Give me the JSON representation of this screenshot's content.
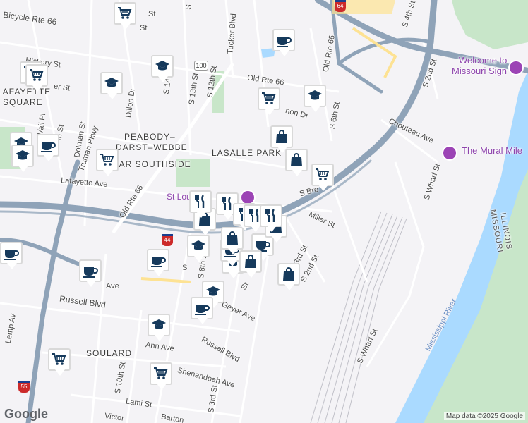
{
  "map": {
    "colors": {
      "land": "#f4f3f6",
      "water": "#aadaff",
      "park": "#c8e6c9",
      "highway": "#8fa3b8",
      "road": "#ffffff",
      "rail": "#b8b8c0",
      "pin_icon": "#163a5c",
      "poi": "#9c44b5"
    },
    "neighborhoods": {
      "lafayette_square_1": "LAFAYETTE",
      "lafayette_square_2": "SQUARE",
      "peabody_1": "PEABODY–",
      "peabody_2": "DARST–WEBBE",
      "lasalle_park": "LASALLE PARK",
      "near_southside": "NEAR SOUTHSIDE",
      "soulard": "SOULARD"
    },
    "roads": {
      "bicycle_rte": "Bicycle Rte 66",
      "old_rte_66_top": "Old Rte 66",
      "old_rte_66_mid": "Old Rte 66",
      "old_rte_66_left": "Old Rte 66",
      "tucker_blvd": "Tucker Blvd",
      "s_14th": "S 14th",
      "s_13th": "S 13th St",
      "s_12th": "S 12th St",
      "s_6th": "S 6th St",
      "s_4th": "S 4th St",
      "s_2nd_top": "S 2nd St",
      "s_2nd": "S 2nd St",
      "s_3rd": "S 3rd St",
      "s_3rd_bottom": "S 3rd St",
      "s_8th": "S 8th St",
      "s_10th": "S 10th St",
      "s_wharf_top": "S Wharf St",
      "s_wharf_bottom": "S Wharf St",
      "s_broadway": "S Bro",
      "chouteau": "Chouteau Ave",
      "miller": "Miller St",
      "lafayette_ave": "Lafayette Ave",
      "truman": "Truman Pkwy",
      "dolman": "Dolman St",
      "dillon": "Dillon Dr",
      "vail": "Vail Pl",
      "hickory": "Hickory St",
      "mississippi_ave": "er St",
      "st_top": "St",
      "s_st_top": "S",
      "st_vincent": "St",
      "russell_left": "Russell Blvd",
      "russell_bottom": "Russell Blvd",
      "ann": "Ann Ave",
      "lami": "Lami St",
      "shenandoah": "Shenandoah Ave",
      "barton": "Barton",
      "victor": "Victor",
      "lemp": "Lemp Av",
      "geyer": "Geyer Ave",
      "park_ave": "Ave",
      "lasalle_st": "non Dr",
      "fifth_st": "th St",
      "st_louis": "St Lou",
      "s_bottom": "S",
      "st_mid": "St"
    },
    "shields": {
      "us100": "100",
      "i44": "44",
      "i55": "55",
      "i64": "64"
    },
    "pois": {
      "welcome_1": "Welcome to",
      "welcome_2": "Missouri Sign",
      "mural_mile": "The Mural Mile"
    },
    "water_labels": {
      "river": "Mississippi River"
    },
    "state_labels": {
      "missouri": "MISSOURI",
      "illinois": "ILLINOIS"
    },
    "attribution": "Map data ©2025 Google",
    "logo": "Google",
    "pins": [
      {
        "type": "cart"
      },
      {
        "type": "cart"
      },
      {
        "type": "cart"
      },
      {
        "type": "cart"
      },
      {
        "type": "cart"
      },
      {
        "type": "cart"
      },
      {
        "type": "cart"
      },
      {
        "type": "cart"
      },
      {
        "type": "school"
      },
      {
        "type": "school"
      },
      {
        "type": "school"
      },
      {
        "type": "school"
      },
      {
        "type": "school"
      },
      {
        "type": "school"
      },
      {
        "type": "school"
      },
      {
        "type": "school"
      },
      {
        "type": "school"
      },
      {
        "type": "coffee"
      },
      {
        "type": "coffee"
      },
      {
        "type": "coffee"
      },
      {
        "type": "coffee"
      },
      {
        "type": "coffee"
      },
      {
        "type": "coffee"
      },
      {
        "type": "coffee"
      },
      {
        "type": "coffee"
      },
      {
        "type": "bag"
      },
      {
        "type": "bag"
      },
      {
        "type": "bag"
      },
      {
        "type": "bag"
      },
      {
        "type": "bag"
      },
      {
        "type": "bag"
      },
      {
        "type": "bag"
      },
      {
        "type": "fork"
      },
      {
        "type": "fork"
      },
      {
        "type": "fork"
      },
      {
        "type": "fork"
      },
      {
        "type": "fork"
      }
    ]
  }
}
